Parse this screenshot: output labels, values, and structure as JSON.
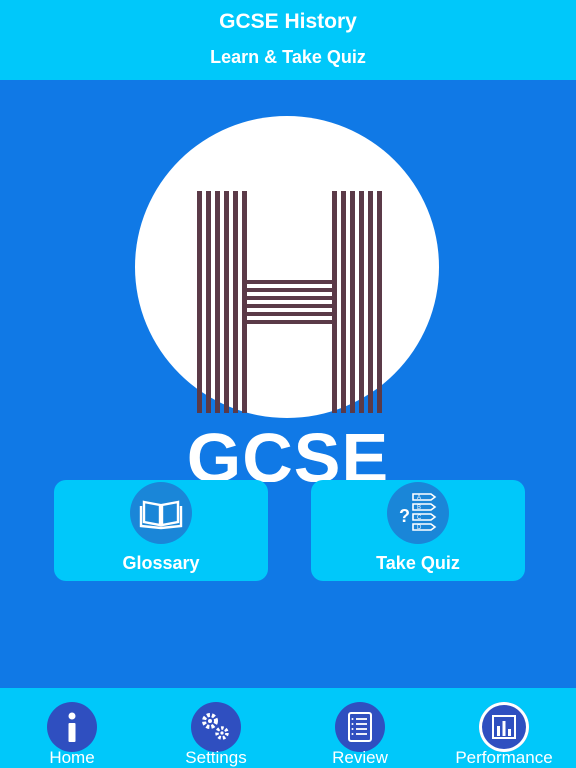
{
  "header": {
    "title": "GCSE History",
    "subtitle": "Learn & Take Quiz"
  },
  "logo": {
    "text": "GCSE",
    "icon": "h-letter-logo",
    "stripe_color": "#5b3a48"
  },
  "cards": [
    {
      "label": "Glossary",
      "icon": "book-icon"
    },
    {
      "label": "Take Quiz",
      "icon": "quiz-icon"
    }
  ],
  "tabbar": {
    "items": [
      {
        "label": "Home",
        "icon": "info-icon"
      },
      {
        "label": "Settings",
        "icon": "gears-icon"
      },
      {
        "label": "Review",
        "icon": "review-list-icon"
      },
      {
        "label": "Performance",
        "icon": "bar-chart-icon",
        "active": true
      }
    ]
  },
  "colors": {
    "header_bg": "#00c8fa",
    "main_bg": "#1079e6",
    "card_bg": "#00c8fa",
    "tab_icon_bg": "#2f4fc0"
  }
}
